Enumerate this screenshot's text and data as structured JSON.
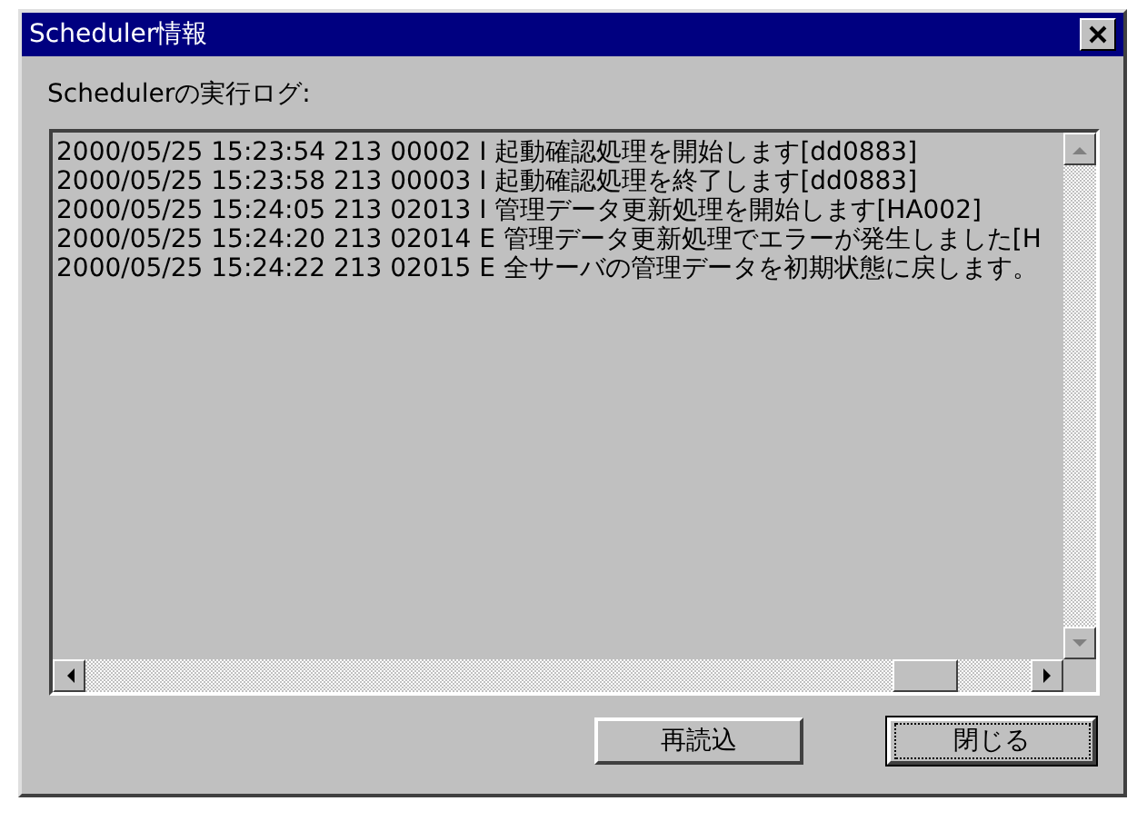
{
  "window": {
    "title": "Scheduler情報"
  },
  "log_label": "Schedulerの実行ログ:",
  "log_lines": [
    "2000/05/25 15:23:54 213 00002 I 起動確認処理を開始します[dd0883]",
    "2000/05/25 15:23:58 213 00003 I 起動確認処理を終了します[dd0883]",
    "2000/05/25 15:24:05 213 02013 I 管理データ更新処理を開始します[HA002]",
    "2000/05/25 15:24:20 213 02014 E 管理データ更新処理でエラーが発生しました[H",
    "2000/05/25 15:24:22 213 02015 E 全サーバの管理データを初期状態に戻します。"
  ],
  "buttons": [
    {
      "label": "再読込",
      "default": false
    },
    {
      "label": "閉じる",
      "default": true
    }
  ]
}
